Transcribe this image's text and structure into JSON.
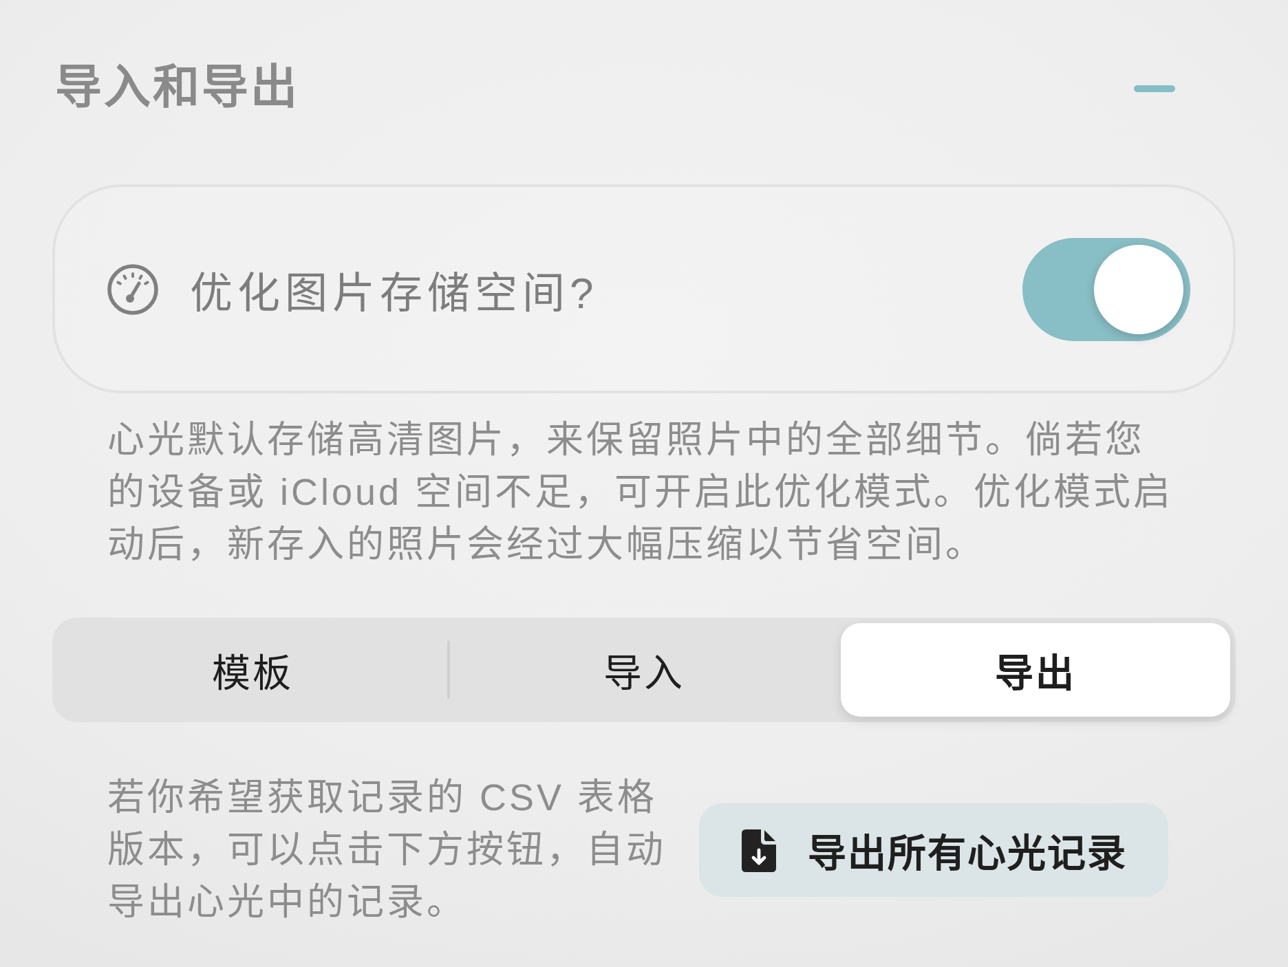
{
  "section": {
    "title": "导入和导出",
    "expanded": true
  },
  "storage_option": {
    "label": "优化图片存储空间?",
    "on": true
  },
  "storage_note": "心光默认存储高清图片，来保留照片中的全部细节。倘若您的设备或 iCloud 空间不足，可开启此优化模式。优化模式启动后，新存入的照片会经过大幅压缩以节省空间。",
  "tabs": [
    {
      "label": "模板",
      "selected": false
    },
    {
      "label": "导入",
      "selected": false
    },
    {
      "label": "导出",
      "selected": true
    }
  ],
  "export": {
    "note": "若你希望获取记录的 CSV 表格版本，可以点击下方按钮，自动导出心光中的记录。",
    "button": "导出所有心光记录"
  }
}
